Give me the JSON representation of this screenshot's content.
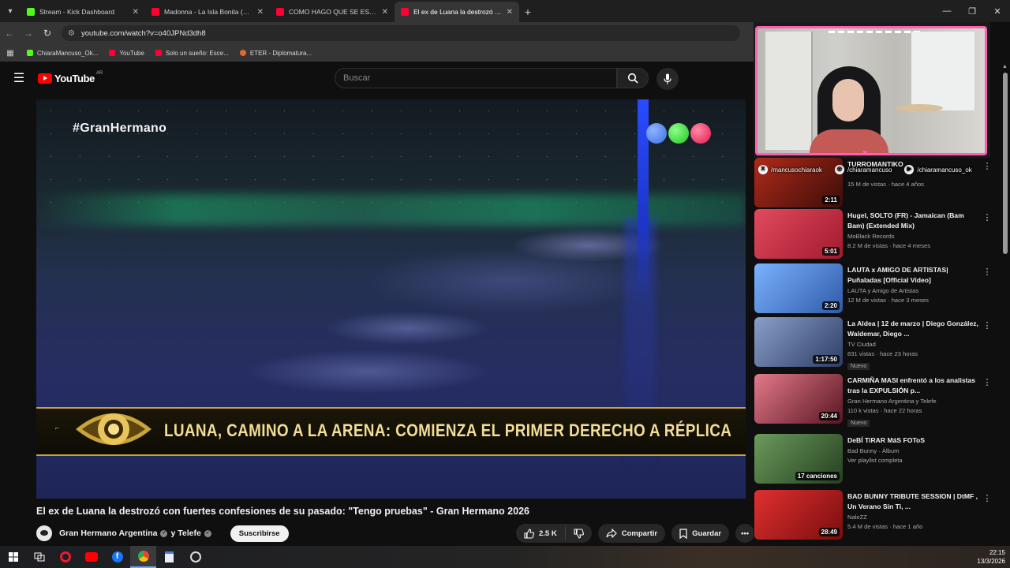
{
  "browser": {
    "tabs": [
      {
        "title": "Stream - Kick Dashboard",
        "color": "#53fc18",
        "active": false
      },
      {
        "title": "Madonna - La Isla Bonita (millio",
        "color": "#ff0033",
        "active": false
      },
      {
        "title": "COMO HAGO QUE SE ESCUCHE",
        "color": "#ff0033",
        "active": false
      },
      {
        "title": "El ex de Luana la destrozó con f",
        "color": "#ff0033",
        "active": true
      }
    ],
    "url": "youtube.com/watch?v=o40JPNd3dh8",
    "bookmarks": [
      {
        "label": "ChiaraMancuso_Ok...",
        "color": "#53fc18"
      },
      {
        "label": "YouTube",
        "color": "#ff0033"
      },
      {
        "label": "Solo un sueño: Esce...",
        "color": "#ff0033"
      },
      {
        "label": "ETER - Diplomatura...",
        "color": "#e06b2a"
      }
    ]
  },
  "masthead": {
    "logo_text": "YouTube",
    "country": "AR",
    "search_placeholder": "Buscar"
  },
  "video": {
    "overlay_hashtag": "#GranHermano",
    "lower_third": "LUANA, CAMINO A LA ARENA: COMIENZA EL PRIMER DERECHO A RÉPLICA",
    "title": "El ex de Luana la destrozó con fuertes confesiones de su pasado: \"Tengo pruebas\" - Gran Hermano 2026",
    "channel": "Gran Hermano Argentina",
    "collab": "y Telefe",
    "subscribe_label": "Suscribirse",
    "likes": "2.5 K",
    "share_label": "Compartir",
    "save_label": "Guardar"
  },
  "overlay": {
    "socials": [
      {
        "icon": "x-icon",
        "handle": "/mancusochiaraok"
      },
      {
        "icon": "instagram-icon",
        "handle": "/chiaramancuso"
      },
      {
        "icon": "youtube-icon",
        "handle": "/chiaramancuso_ok"
      }
    ]
  },
  "recommendations": [
    {
      "title": "TURROMANTIKO",
      "channel": "",
      "meta": "15 M de vistas · hace 4 años",
      "duration": "2:11",
      "badge": "",
      "thumb": "#7a1b12"
    },
    {
      "title": "Hugel, SOLTO (FR) - Jamaican (Bam Bam) (Extended Mix)",
      "channel": "MoBlack Records",
      "meta": "8.2 M de vistas · hace 4 meses",
      "duration": "5:01",
      "badge": "",
      "thumb": "#d2324a"
    },
    {
      "title": "LAUTA x AMIGO DE ARTISTAS| Puñaladas [Official Video]",
      "channel": "LAUTA y Amigo de Artistas",
      "meta": "12 M de vistas · hace 3 meses",
      "duration": "2:20",
      "badge": "",
      "thumb": "#3d6fb8"
    },
    {
      "title": "La Aldea | 12 de marzo | Diego González, Waldemar, Diego ...",
      "channel": "TV Ciudad",
      "meta": "831 vistas · hace 23 horas",
      "duration": "1:17:50",
      "badge": "Nuevo",
      "thumb": "#4a5d8a"
    },
    {
      "title": "CARMIÑA MASI enfrentó a los analistas tras la EXPULSIÓN p...",
      "channel": "Gran Hermano Argentina",
      "collab": "y Telefe",
      "meta": "110 k vistas · hace 22 horas",
      "duration": "20:44",
      "badge": "Nuevo",
      "thumb": "#a8344a"
    },
    {
      "title": "DeBÍ TiRAR MáS FOToS",
      "channel": "Bad Bunny · Álbum",
      "meta": "Ver playlist completa",
      "duration": "17 canciones",
      "badge": "",
      "thumb": "#3f6b3a"
    },
    {
      "title": "BAD BUNNY TRIBUTE SESSION | DtMF , Un Verano Sin Ti, ...",
      "channel": "NaleZZ",
      "meta": "5.4 M de vistas · hace 1 año",
      "duration": "28:49",
      "badge": "",
      "thumb": "#c42020"
    }
  ],
  "system": {
    "time": "22:15",
    "date": "13/3/2026"
  }
}
